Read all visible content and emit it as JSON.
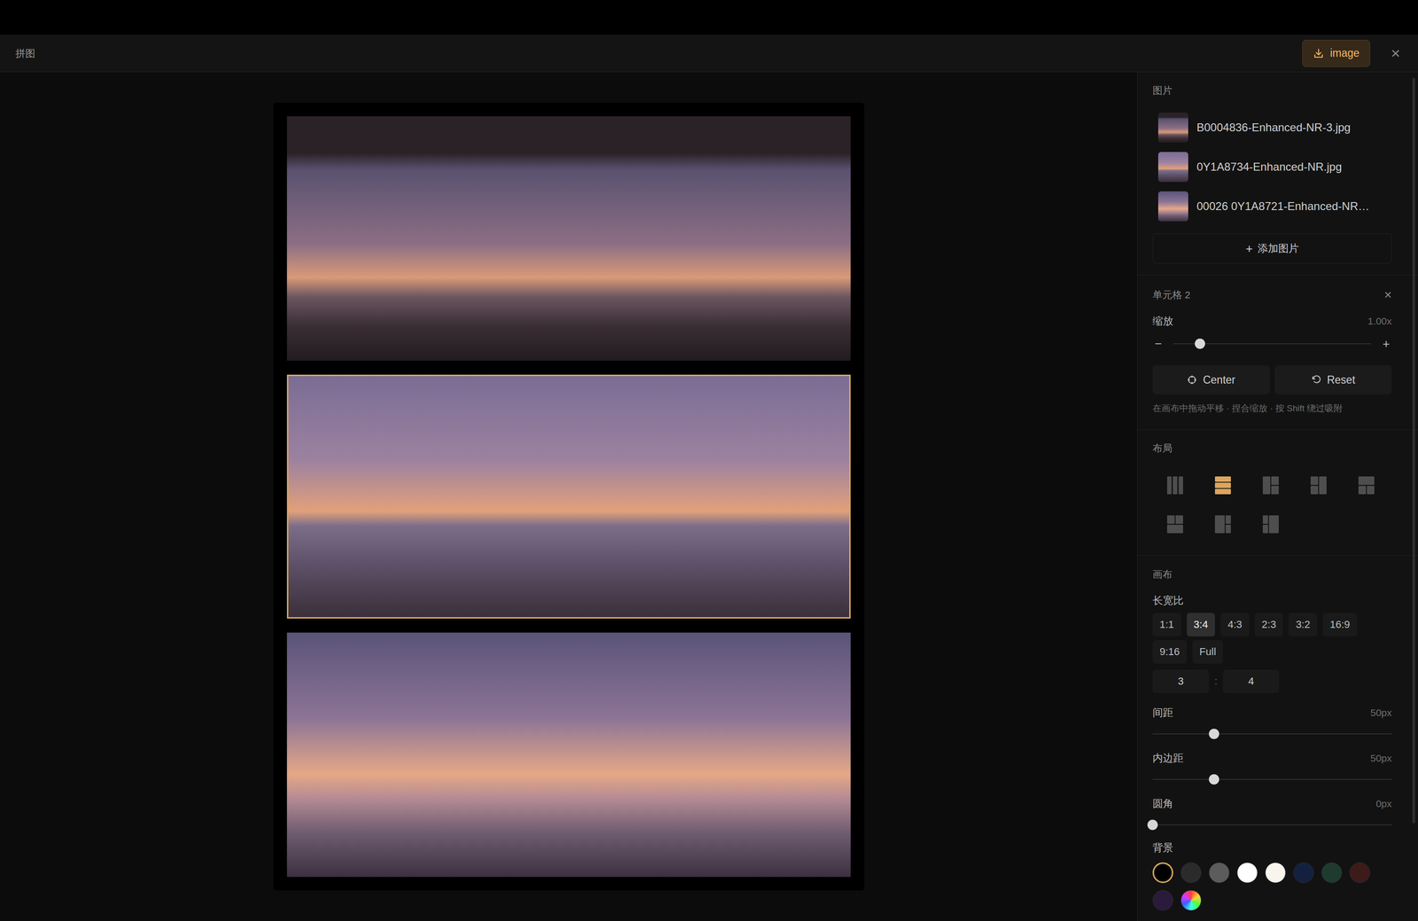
{
  "header": {
    "title": "拼图",
    "download_label": "image",
    "close": "×"
  },
  "canvas": {
    "cells": [
      {
        "selected": false
      },
      {
        "selected": true
      },
      {
        "selected": false
      }
    ]
  },
  "images": {
    "title": "图片",
    "items": [
      {
        "name": "B0004836-Enhanced-NR-3.jpg"
      },
      {
        "name": "0Y1A8734-Enhanced-NR.jpg"
      },
      {
        "name": "00026 0Y1A8721-Enhanced-NR…"
      }
    ],
    "add_icon": "+",
    "add_label": "添加图片"
  },
  "cell": {
    "title": "单元格 2",
    "close": "×",
    "zoom_label": "缩放",
    "zoom_reading": "1.00x",
    "zoom_level": 0.135,
    "minus": "−",
    "plus": "+",
    "center_label": "Center",
    "reset_label": "Reset",
    "hint": "在画布中拖动平移 · 捏合缩放 · 按 Shift 绕过吸附"
  },
  "layout": {
    "title": "布局",
    "options": [
      {
        "kind": "columns",
        "selected": false
      },
      {
        "kind": "rows",
        "selected": true
      },
      {
        "kind": "left",
        "selected": false
      },
      {
        "kind": "right",
        "selected": false
      },
      {
        "kind": "top",
        "selected": false
      },
      {
        "kind": "bottom",
        "selected": false
      },
      {
        "kind": "leftwide",
        "selected": false
      },
      {
        "kind": "rightwide",
        "selected": false
      }
    ]
  },
  "canvas_settings": {
    "title": "画布",
    "ratio_label": "长宽比",
    "ratios": [
      {
        "label": "1:1",
        "selected": false
      },
      {
        "label": "3:4",
        "selected": true
      },
      {
        "label": "4:3",
        "selected": false
      },
      {
        "label": "2:3",
        "selected": false
      },
      {
        "label": "3:2",
        "selected": false
      },
      {
        "label": "16:9",
        "selected": false
      },
      {
        "label": "9:16",
        "selected": false
      },
      {
        "label": "Full",
        "selected": false
      }
    ],
    "custom": {
      "width": "3",
      "separator": ":",
      "height": "4"
    },
    "sliders": [
      {
        "label": "间距",
        "reading": "50px",
        "level": 0.256
      },
      {
        "label": "内边距",
        "reading": "50px",
        "level": 0.256
      },
      {
        "label": "圆角",
        "reading": "0px",
        "level": 0
      }
    ],
    "background": {
      "label": "背景",
      "swatches": [
        {
          "kind": "color",
          "color": "#000000",
          "selected": true
        },
        {
          "kind": "color",
          "color": "#2b2b2b",
          "selected": false
        },
        {
          "kind": "color",
          "color": "#5c5c5c",
          "selected": false
        },
        {
          "kind": "color",
          "color": "#ffffff",
          "selected": false
        },
        {
          "kind": "color",
          "color": "#f8f5ee",
          "selected": false
        },
        {
          "kind": "color",
          "color": "#13213f",
          "selected": false
        },
        {
          "kind": "color",
          "color": "#1f3b2f",
          "selected": false
        },
        {
          "kind": "color",
          "color": "#3d1b1b",
          "selected": false
        },
        {
          "kind": "color",
          "color": "#2b1b3b",
          "selected": false
        },
        {
          "kind": "picker",
          "color": "#ff0000",
          "selected": false
        }
      ]
    }
  }
}
